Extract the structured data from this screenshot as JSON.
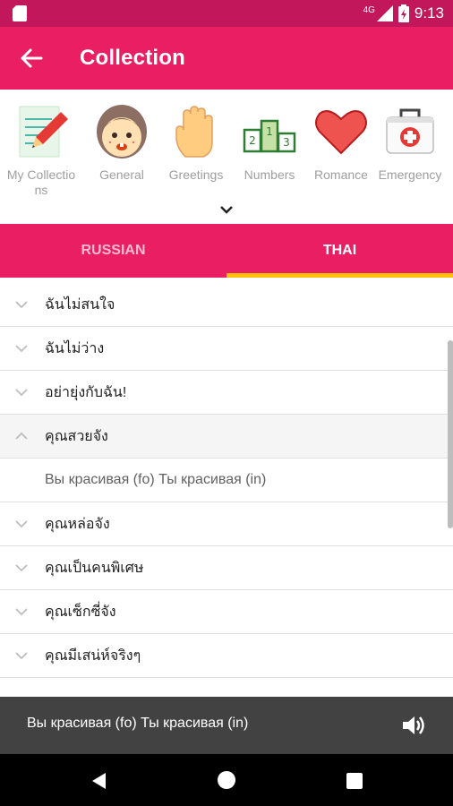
{
  "status_bar": {
    "network": "4G",
    "time": "9:13"
  },
  "app_bar": {
    "title": "Collection",
    "back_icon": "arrow-left-icon"
  },
  "categories": [
    {
      "label": "My Collections",
      "icon": "notebook-pencil-icon"
    },
    {
      "label": "General",
      "icon": "girl-face-icon"
    },
    {
      "label": "Greetings",
      "icon": "waving-hand-icon"
    },
    {
      "label": "Numbers",
      "icon": "podium-icon"
    },
    {
      "label": "Romance",
      "icon": "heart-icon"
    },
    {
      "label": "Emergency",
      "icon": "first-aid-kit-icon"
    }
  ],
  "tabs": [
    {
      "label": "RUSSIAN",
      "selected": false
    },
    {
      "label": "THAI",
      "selected": true
    }
  ],
  "phrases": [
    {
      "text": "ฉันไม่สนใจ",
      "expanded": false
    },
    {
      "text": "ฉันไม่ว่าง",
      "expanded": false
    },
    {
      "text": "อย่ายุ่งกับฉัน!",
      "expanded": false
    },
    {
      "text": "คุณสวยจัง",
      "expanded": true,
      "detail": "Вы красивая (fo)  Ты красивая (in)"
    },
    {
      "text": "คุณหล่อจัง",
      "expanded": false
    },
    {
      "text": "คุณเป็นคนพิเศษ",
      "expanded": false
    },
    {
      "text": "คุณเซ็กซี่จัง",
      "expanded": false
    },
    {
      "text": "คุณมีเสน่ห์จริงๆ",
      "expanded": false
    }
  ],
  "player": {
    "text": "Вы красивая (fo)  Ты красивая (in)",
    "icon": "volume-icon"
  },
  "colors": {
    "primary": "#e91e63",
    "primary_dark": "#c2185b",
    "tab_indicator": "#ffc107",
    "player_bg": "#424242"
  }
}
